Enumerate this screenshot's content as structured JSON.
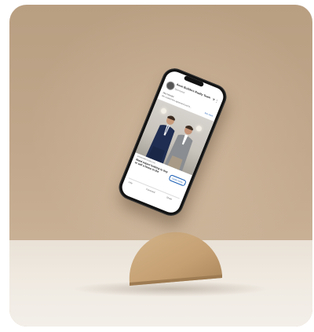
{
  "post": {
    "author": "Anne Builders Realty Team",
    "sponsored": "Sponsored",
    "caption": "Hey friends!",
    "link_text": "We created this agreement just fo...",
    "see_more": "See more",
    "site": "annebuildersrealty.com",
    "headline": "Need expert looking to buy or sell a home in the",
    "cta": "Learn more",
    "actions": [
      "Like",
      "Comment",
      "Share"
    ]
  },
  "icons": {
    "close": "close-icon",
    "more": "more-options-icon"
  },
  "colors": {
    "background_wall": "#c1a78b",
    "floor": "#efe9e0",
    "stand": "#c9a77c",
    "phone_frame": "#121212",
    "link_blue": "#1a5fb4"
  }
}
